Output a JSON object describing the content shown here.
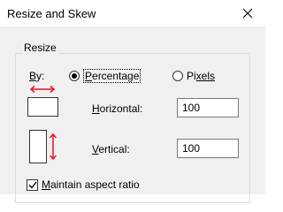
{
  "window": {
    "title": "Resize and Skew"
  },
  "resize_group": {
    "label": "Resize",
    "by_label_first": "B",
    "by_label_rest": "y:",
    "options": [
      {
        "label_first": "P",
        "label_rest": "ercentage",
        "checked": true
      },
      {
        "label_first": "Pi",
        "label_rest": "xels",
        "checked": false
      }
    ],
    "horizontal": {
      "label_first": "H",
      "label_rest": "orizontal:",
      "value": "100"
    },
    "vertical": {
      "label_first": "V",
      "label_rest": "ertical:",
      "value": "100"
    },
    "maintain_aspect": {
      "label_first": "M",
      "label_rest": "aintain aspect ratio",
      "checked": true
    }
  },
  "colors": {
    "arrow": "#e81123"
  }
}
